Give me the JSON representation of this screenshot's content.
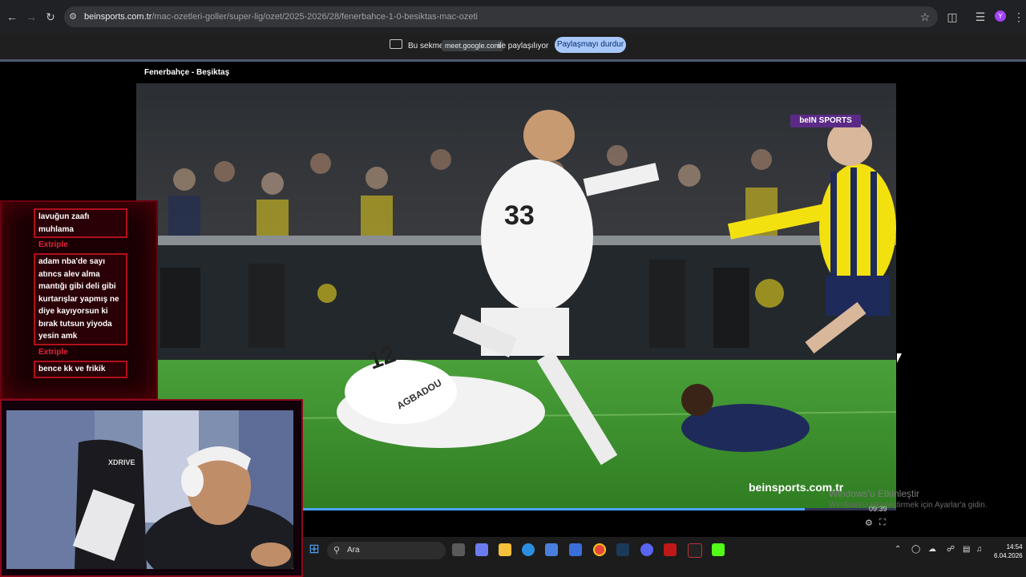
{
  "browser": {
    "url_host": "beinsports.com.tr",
    "url_path": "/mac-ozetleri-goller/super-lig/ozet/2025-2026/28/fenerbahce-1-0-besiktas-mac-ozeti",
    "profile_initial": "Y"
  },
  "sharing": {
    "text_before": "Bu sekme",
    "domain": "meet.google.com",
    "text_after": "ile paylaşılıyor",
    "stop_button": "Paylaşmayı durdur"
  },
  "video": {
    "title": "Fenerbahçe - Beşiktaş",
    "channel_logo": "beIN SPORTS",
    "watermark": "beinsports.com.tr",
    "time": "09:39",
    "progress": 0.88,
    "player_33": "33",
    "player_12": "12",
    "player_name": "AGBADOU"
  },
  "windows_activation": {
    "line1": "Windows'u Etkinleştir",
    "line2": "Windows'u etkinleştirmek için Ayarlar'a gidin."
  },
  "chat": {
    "messages": [
      {
        "user": "Extriple",
        "text": "lavuğun zaafı muhlama"
      },
      {
        "user": "Extriple",
        "text": "adam nba'de sayı atıncs alev alma mantığı gibi deli gibi kurtarışlar yapmış ne diye kayıyorsun ki bırak tutsun yiyoda yesin amk"
      },
      {
        "user": "Extriple",
        "text": "bence kk ve frikik"
      }
    ]
  },
  "webcam": {
    "chair_brand": "XDRIVE"
  },
  "taskbar": {
    "search_placeholder": "Ara",
    "clock_time": "14:54",
    "clock_date": "6.04.2026"
  },
  "colors": {
    "accent_red": "#b0101c",
    "share_button": "#a8c7fa",
    "pitch_green": "#3f8f2a",
    "fener_yellow": "#f2e10f",
    "fener_navy": "#1e2a5a"
  }
}
